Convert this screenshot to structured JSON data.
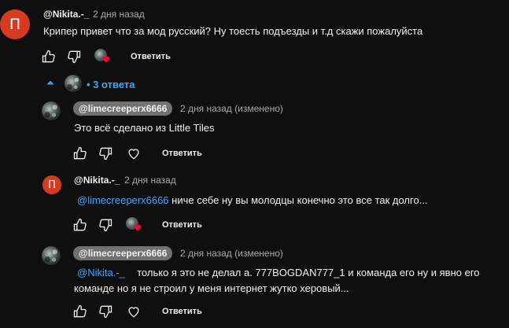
{
  "top_comment": {
    "avatar_letter": "П",
    "author": "@Nikita.-_",
    "time": "2 дня назад",
    "text": "Крипер привет что за мод русский? Ну тоесть подъезды и т.д скажи пожалуйста",
    "reply_label": "Ответить"
  },
  "replies_toggle": {
    "count_label": "3 ответа"
  },
  "replies": [
    {
      "author": "@limecreeperx6666",
      "time": "2 дня назад (изменено)",
      "text": "Это всё сделано из Little Tiles",
      "reply_label": "Ответить"
    },
    {
      "avatar_letter": "П",
      "author": "@Nikita.-_",
      "time": "2 дня назад",
      "mention": "@limecreeperx6666",
      "text": "ниче себе ну вы молодцы конечно это все так долго...",
      "reply_label": "Ответить"
    },
    {
      "author": "@limecreeperx6666",
      "time": "2 дня назад (изменено)",
      "mention": "@Nikita.-_",
      "text_line1": "только я это не делал а. 777BOGDAN777_1 и команда его ну и явно его",
      "text_line2": "команде но я не строил у меня интернет жутко херовый...",
      "reply_label": "Ответить"
    }
  ],
  "colors": {
    "background": "#0f0f0f",
    "accent_blue": "#3ea6ff",
    "heart_red": "#ff0033",
    "avatar_red": "#d63b1f"
  }
}
